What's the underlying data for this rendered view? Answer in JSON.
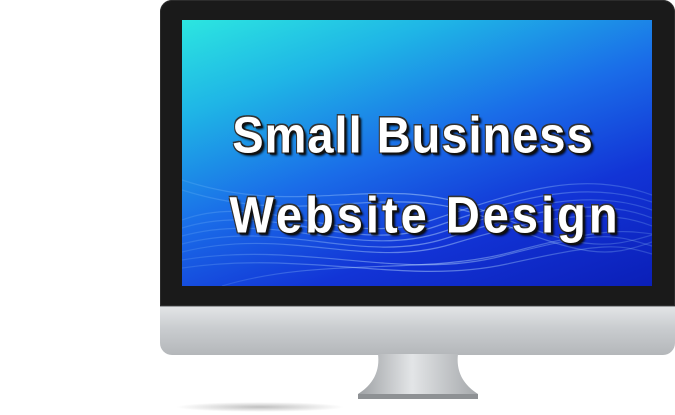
{
  "screen": {
    "headline_line1": "Small Business",
    "headline_line2": "Website Design"
  },
  "colors": {
    "bezel": "#1a1a1a",
    "screen_top": "#2ce6e0",
    "screen_bottom": "#0b1fb8",
    "chin": "#c9cccf",
    "text": "#ffffff"
  }
}
